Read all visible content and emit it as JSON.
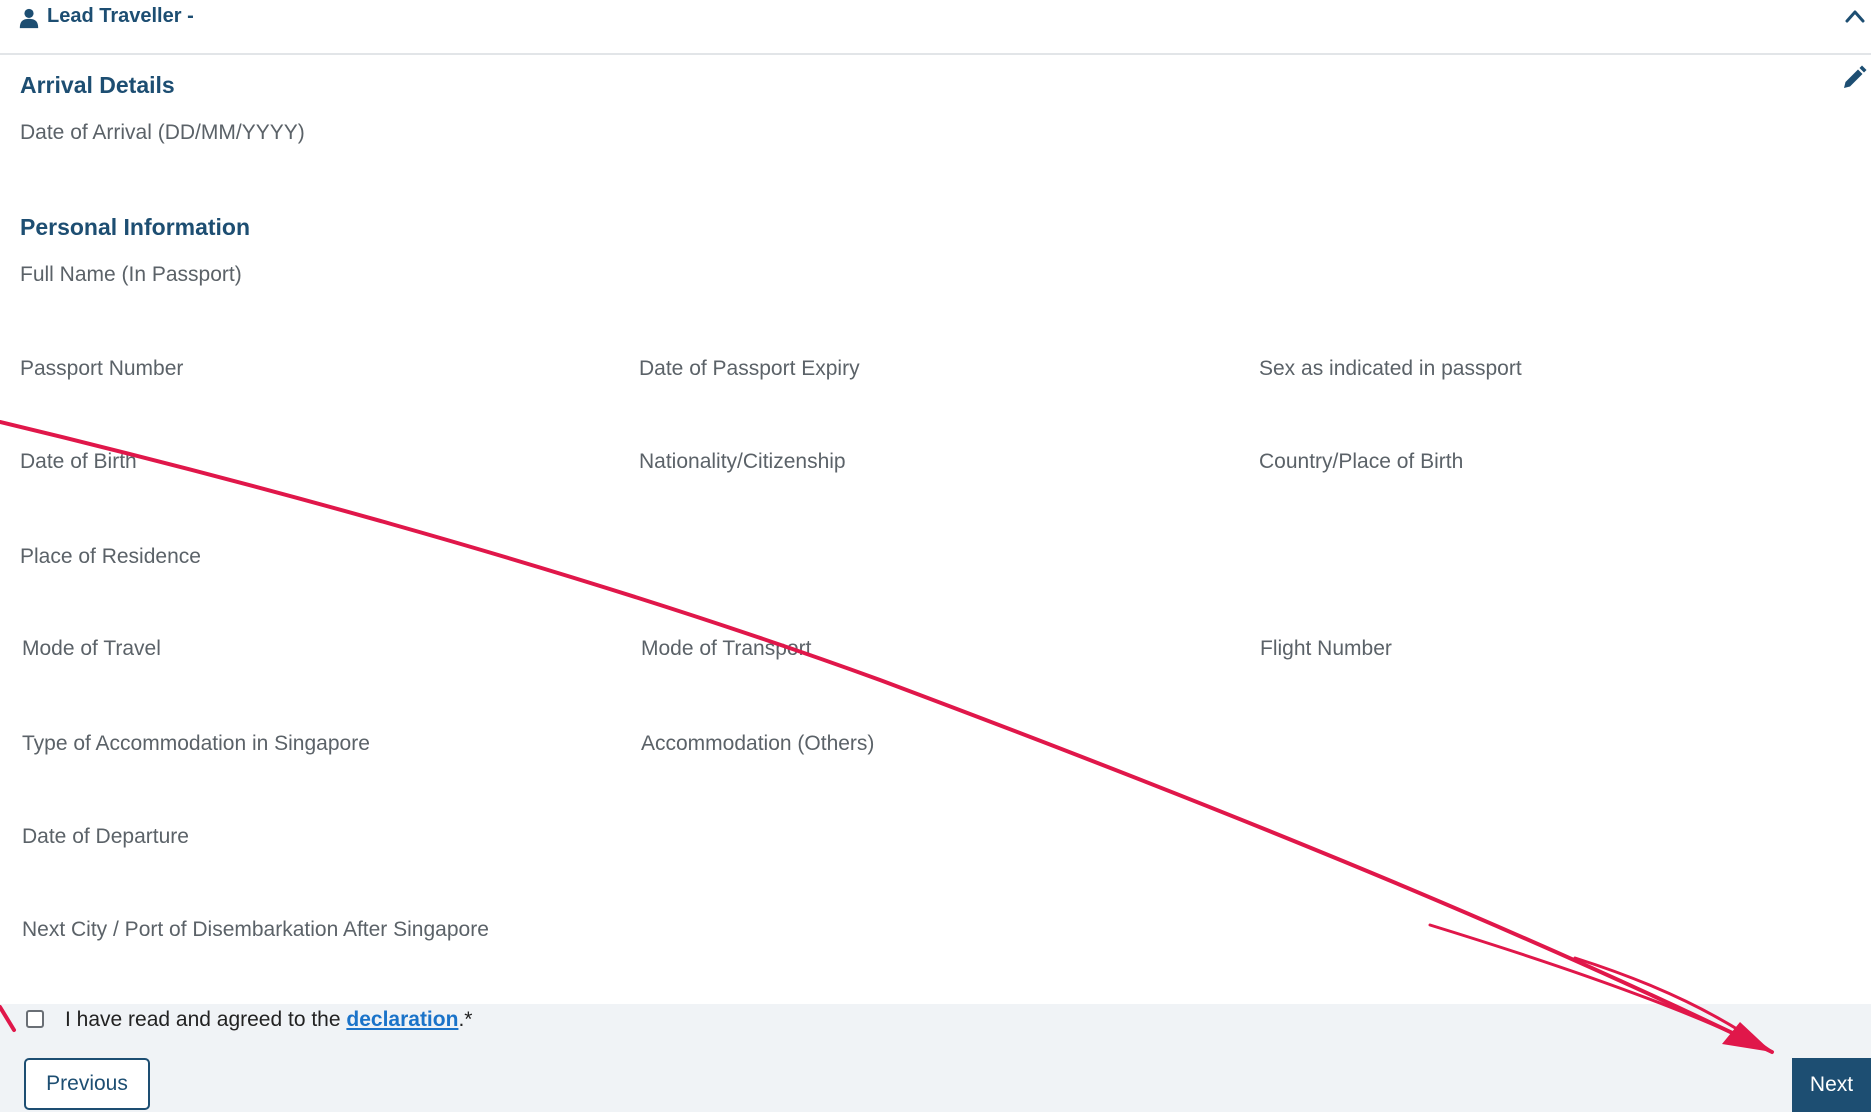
{
  "header": {
    "title": "Lead Traveller -"
  },
  "sections": {
    "arrival_title": "Arrival Details",
    "personal_title": "Personal Information"
  },
  "fields": {
    "date_of_arrival": "Date of Arrival (DD/MM/YYYY)",
    "full_name": "Full Name (In Passport)",
    "passport_number": "Passport Number",
    "passport_expiry": "Date of Passport Expiry",
    "sex": "Sex as indicated in passport",
    "date_of_birth": "Date of Birth",
    "nationality": "Nationality/Citizenship",
    "country_of_birth": "Country/Place of Birth",
    "place_of_residence": "Place of Residence",
    "mode_of_travel": "Mode of Travel",
    "mode_of_transport": "Mode of Transport",
    "flight_number": "Flight Number",
    "accommodation_type": "Type of Accommodation in Singapore",
    "accommodation_others": "Accommodation (Others)",
    "date_of_departure": "Date of Departure",
    "next_city": "Next City / Port of Disembarkation After Singapore"
  },
  "footer": {
    "declaration_prefix": "I have read and agreed to the ",
    "declaration_link": "declaration",
    "declaration_suffix": ".*",
    "previous_label": "Previous",
    "next_label": "Next"
  },
  "icons": {
    "header_user": "user-icon",
    "collapse": "chevron-up-icon",
    "edit": "pencil-icon"
  },
  "colors": {
    "primary": "#1d4e72",
    "link": "#1a73c9",
    "annotation_arrow": "#e0174a",
    "footer_bg": "#f0f3f6"
  }
}
